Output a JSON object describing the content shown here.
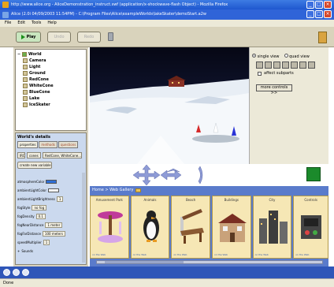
{
  "browser": {
    "title": "http://www.alice.org - AliceDemonstration_instruct.swf (application/x-shockwave-flash Object) - Mozilla Firefox"
  },
  "alice": {
    "title": "Alice (2.0i 04/09/2003 11:54PM) - C:\\Program Files\\Alice\\exampleWorlds\\lakeSkater\\demoStart.a2w",
    "menu": [
      "File",
      "Edit",
      "Tools",
      "Help"
    ]
  },
  "toolbar": {
    "play_label": "Play",
    "undo_label": "Undo",
    "redo_label": "Redo"
  },
  "object_tree": {
    "root": "World",
    "items": [
      "Camera",
      "Light",
      "Ground",
      "RedCone",
      "WhiteCone",
      "BlueCone",
      "Lake",
      "IceSkater"
    ]
  },
  "details": {
    "title": "World's details",
    "tabs": [
      "properties",
      "methods",
      "questions"
    ],
    "dropdown_prefix": "IRC",
    "dropdown_label": "cones",
    "dropdown_value": "RedCone, WhiteCone...",
    "create_var_label": "create new variable",
    "properties": [
      {
        "name": "atmosphereColor",
        "value": ""
      },
      {
        "name": "ambientLightColor",
        "value": ""
      },
      {
        "name": "ambientLightBrightness",
        "value": "1"
      },
      {
        "name": "fogStyle",
        "value": "no fog"
      },
      {
        "name": "fogDensity",
        "value": "0.1"
      },
      {
        "name": "fogNearDistance",
        "value": "1 meter"
      },
      {
        "name": "fogFarDistance",
        "value": "100 meters"
      },
      {
        "name": "speedMultiplier",
        "value": "1"
      },
      {
        "name": "Sounds",
        "value": ""
      }
    ],
    "colors": {
      "atmosphere": "#2f6fd6",
      "ambient": "#ffffff"
    }
  },
  "camera_panel": {
    "single_view": "single view",
    "quad_view": "quad view",
    "affect_subparts": "affect subparts",
    "more_controls": "more controls >>"
  },
  "gallery": {
    "breadcrumb": "Home > Web Gallery",
    "items": [
      {
        "name": "Amusement Park",
        "foot": "on the Web"
      },
      {
        "name": "Animals",
        "foot": "on the Web"
      },
      {
        "name": "Beach",
        "foot": "on the Web"
      },
      {
        "name": "Buildings",
        "foot": "on the Web"
      },
      {
        "name": "City",
        "foot": "on the Web"
      },
      {
        "name": "Controls",
        "foot": "on the Web"
      }
    ]
  },
  "status": {
    "text": "Done"
  }
}
